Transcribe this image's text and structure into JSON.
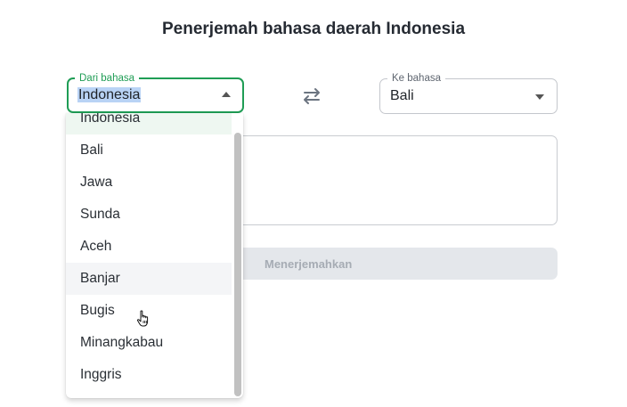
{
  "title": "Penerjemah bahasa daerah Indonesia",
  "from": {
    "label": "Dari bahasa",
    "value": "Indonesia"
  },
  "to": {
    "label": "Ke bahasa",
    "value": "Bali"
  },
  "input": {
    "value": ""
  },
  "translate_button": "Menerjemahkan",
  "icons": {
    "swap": "swap-arrows-icon",
    "caret": "triangle-caret-icon",
    "cursor": "hand-pointer-icon"
  },
  "colors": {
    "accent": "#1f9d55",
    "selection": "#b9d3f5",
    "button_bg": "#e4e7eb",
    "button_text": "#a6acb4"
  },
  "dropdown": {
    "options": [
      "Indonesia",
      "Bali",
      "Jawa",
      "Sunda",
      "Aceh",
      "Banjar",
      "Bugis",
      "Minangkabau",
      "Inggris"
    ],
    "selected": "Indonesia",
    "hovered": "Banjar"
  }
}
